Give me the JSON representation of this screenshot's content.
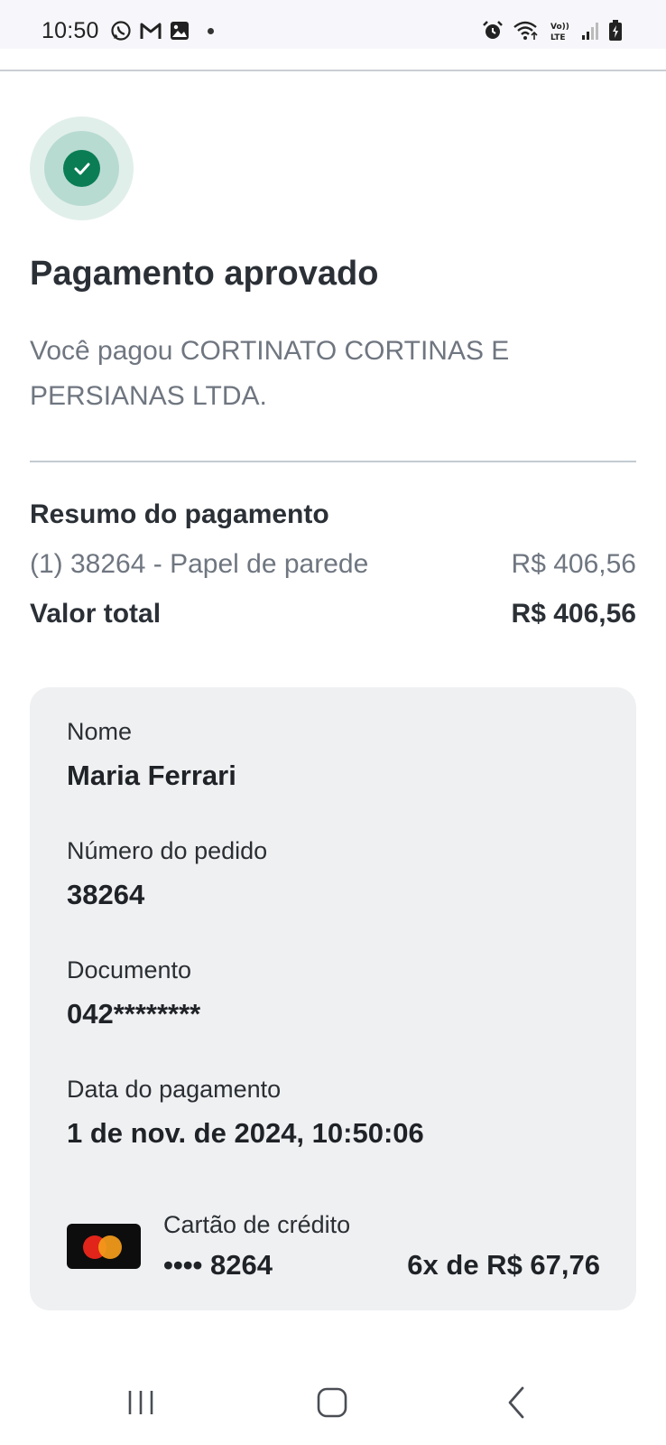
{
  "status_bar": {
    "time": "10:50",
    "left_icons": [
      "whatsapp-icon",
      "gmail-icon",
      "gallery-icon",
      "notification-dot"
    ],
    "right_icons": [
      "alarm-icon",
      "wifi-icon",
      "volte-lte-icon",
      "signal-icon",
      "battery-icon"
    ],
    "volte_label": "Vo)) LTE"
  },
  "header": {
    "title": "Pagamento aprovado",
    "subtitle": "Você pagou CORTINATO CORTINAS E PERSIANAS LTDA."
  },
  "summary": {
    "title": "Resumo do pagamento",
    "item_label": "(1) 38264 - Papel de parede",
    "item_value": "R$ 406,56",
    "total_label": "Valor total",
    "total_value": "R$ 406,56"
  },
  "details": {
    "name_label": "Nome",
    "name_value": "Maria Ferrari",
    "order_label": "Número do pedido",
    "order_value": "38264",
    "document_label": "Documento",
    "document_value": "042********",
    "date_label": "Data do pagamento",
    "date_value": "1 de nov. de 2024, 10:50:06",
    "card_type": "Cartão de crédito",
    "card_number": "•••• 8264",
    "installments": "6x de R$ 67,76",
    "card_brand_icon": "mastercard-icon"
  },
  "colors": {
    "success_green": "#0a7d55",
    "card_background": "#eff0f2",
    "muted_text": "#6f7680"
  },
  "nav_bar": [
    "recent-apps-icon",
    "home-icon",
    "back-icon"
  ]
}
